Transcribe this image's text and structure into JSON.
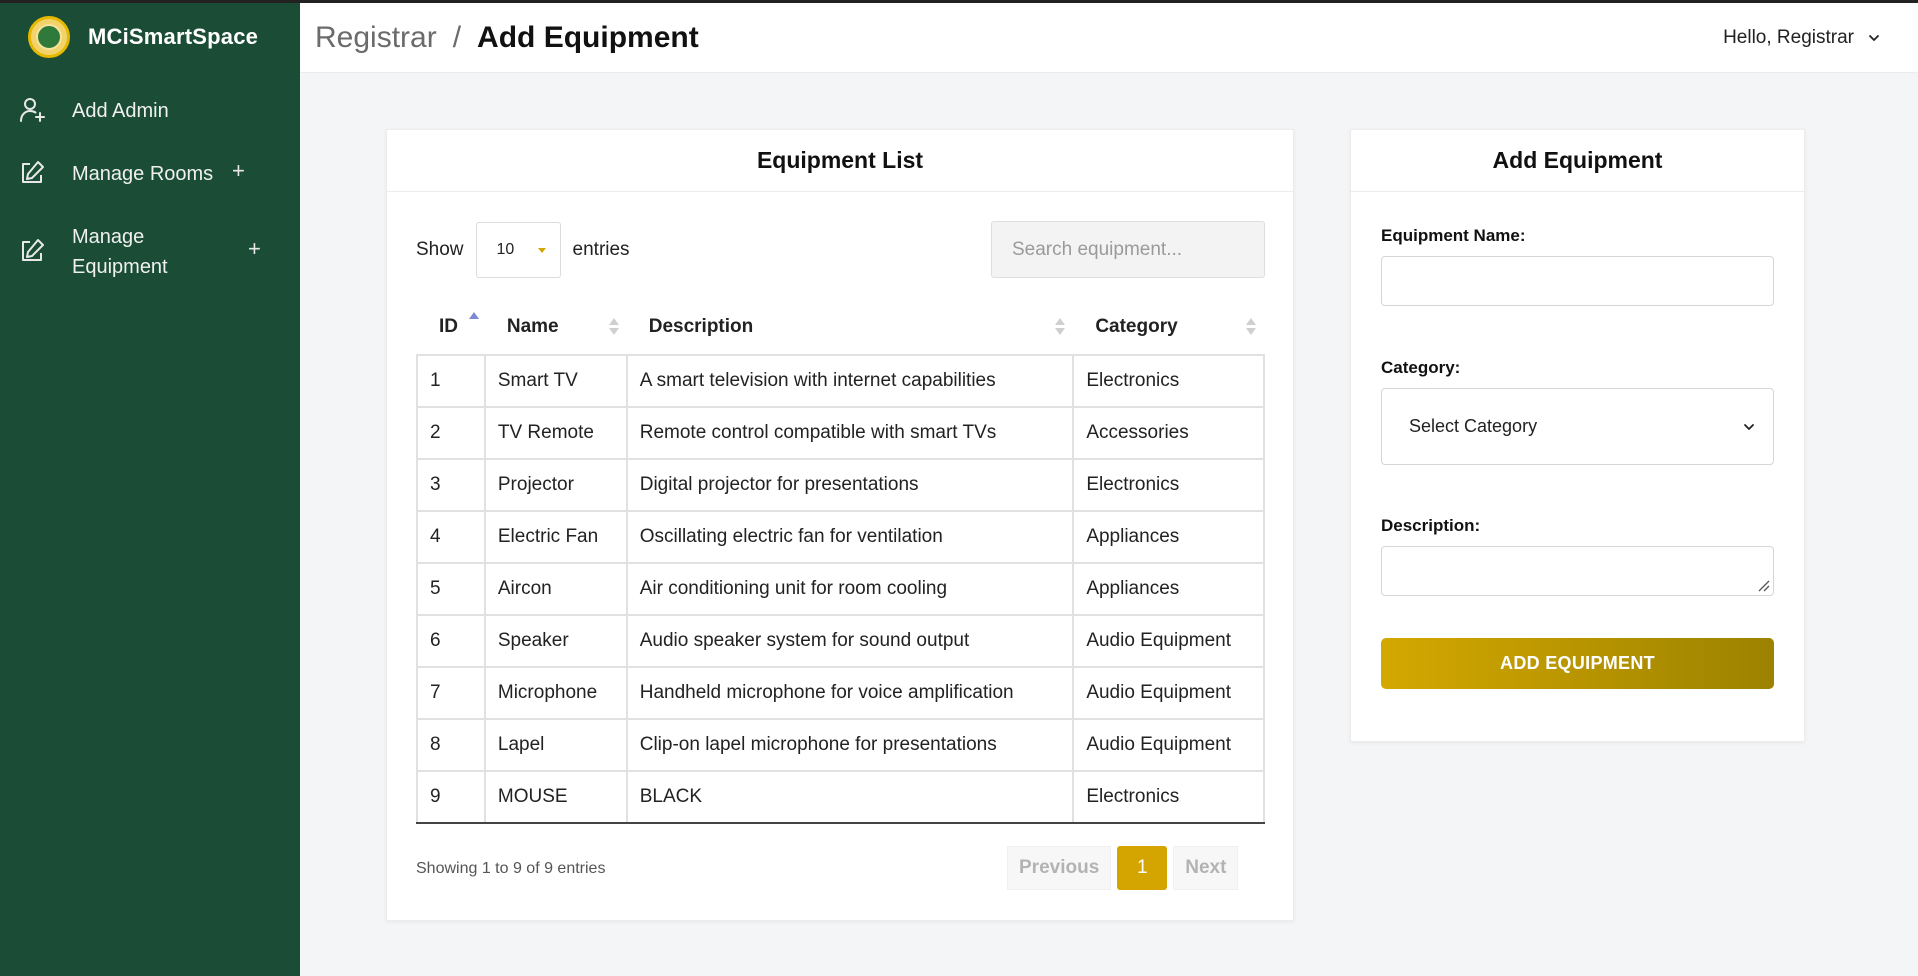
{
  "app": {
    "brand_name": "MCiSmartSpace"
  },
  "sidebar": {
    "items": [
      {
        "label": "Add Admin",
        "icon": "user-plus-icon",
        "expandable": false
      },
      {
        "label": "Manage Rooms",
        "icon": "edit-icon",
        "expandable": true
      },
      {
        "label": "Manage Equipment",
        "label_line1": "Manage",
        "label_line2": "Equipment",
        "icon": "edit-icon",
        "expandable": true
      }
    ],
    "plus_symbol": "+"
  },
  "header": {
    "breadcrumb_parent": "Registrar",
    "breadcrumb_sep": "/",
    "breadcrumb_current": "Add Equipment",
    "greeting": "Hello, Registrar"
  },
  "list": {
    "title": "Equipment List",
    "show_label": "Show",
    "entries_label": "entries",
    "page_size": "10",
    "search_placeholder": "Search equipment...",
    "columns": [
      "ID",
      "Name",
      "Description",
      "Category"
    ],
    "sort_column": "ID",
    "sort_direction": "asc",
    "rows": [
      {
        "id": "1",
        "name": "Smart TV",
        "description": "A smart television with internet capabilities",
        "category": "Electronics"
      },
      {
        "id": "2",
        "name": "TV Remote",
        "description": "Remote control compatible with smart TVs",
        "category": "Accessories"
      },
      {
        "id": "3",
        "name": "Projector",
        "description": "Digital projector for presentations",
        "category": "Electronics"
      },
      {
        "id": "4",
        "name": "Electric Fan",
        "description": "Oscillating electric fan for ventilation",
        "category": "Appliances"
      },
      {
        "id": "5",
        "name": "Aircon",
        "description": "Air conditioning unit for room cooling",
        "category": "Appliances"
      },
      {
        "id": "6",
        "name": "Speaker",
        "description": "Audio speaker system for sound output",
        "category": "Audio Equipment"
      },
      {
        "id": "7",
        "name": "Microphone",
        "description": "Handheld microphone for voice amplification",
        "category": "Audio Equipment"
      },
      {
        "id": "8",
        "name": "Lapel",
        "description": "Clip-on lapel microphone for presentations",
        "category": "Audio Equipment"
      },
      {
        "id": "9",
        "name": "MOUSE",
        "description": "BLACK",
        "category": "Electronics"
      }
    ],
    "info": "Showing 1 to 9 of 9 entries",
    "pagination": {
      "previous": "Previous",
      "current_page": "1",
      "next": "Next"
    }
  },
  "form": {
    "title": "Add Equipment",
    "name_label": "Equipment Name:",
    "name_value": "",
    "category_label": "Category:",
    "category_value": "Select Category",
    "description_label": "Description:",
    "description_value": "",
    "submit_label": "ADD EQUIPMENT"
  },
  "colors": {
    "sidebar_bg": "#1b4d36",
    "accent_gold": "#d4a400",
    "page_bg": "#f4f5f7"
  }
}
